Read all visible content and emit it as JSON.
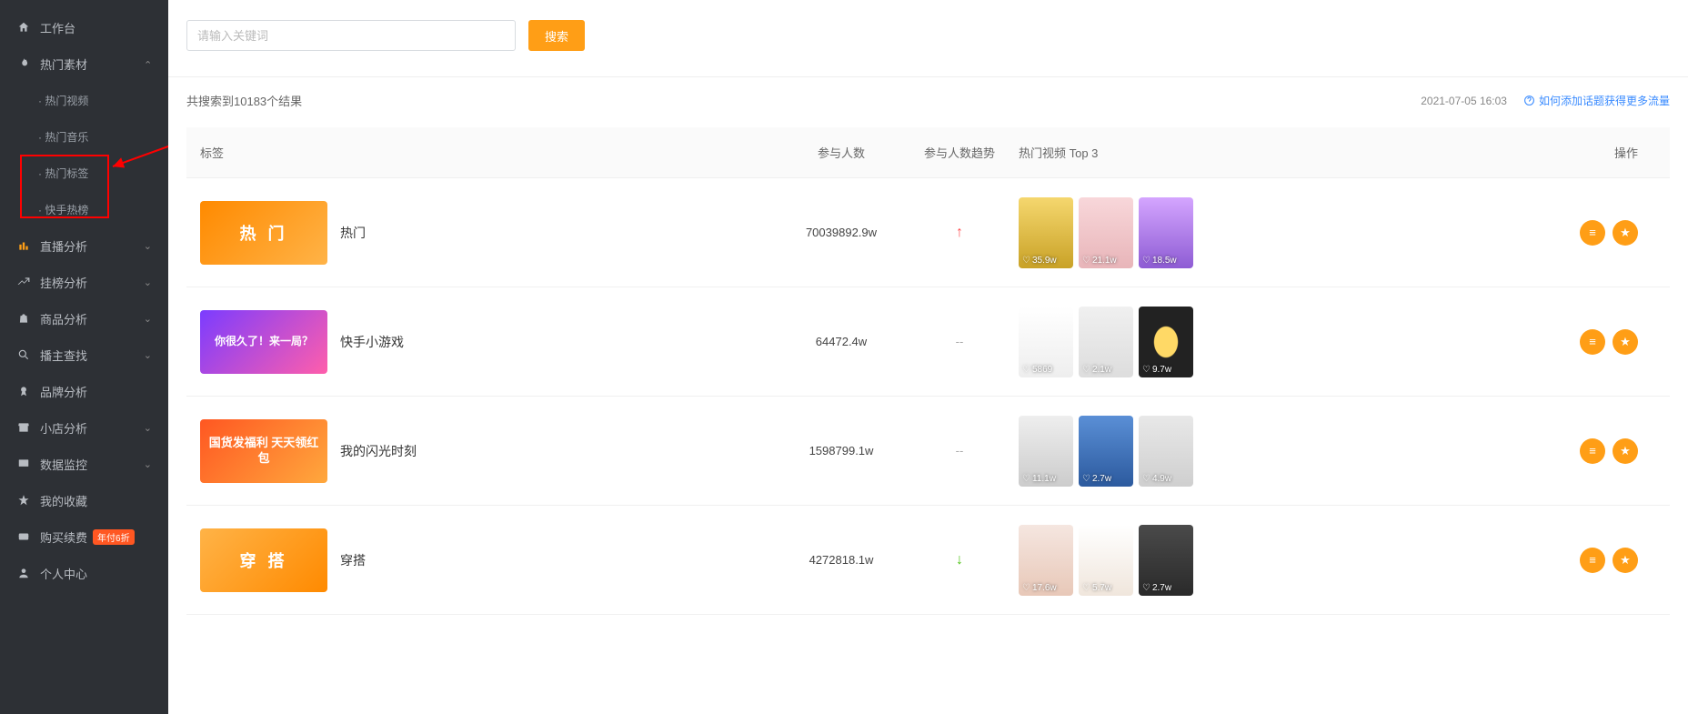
{
  "sidebar": {
    "workbench": "工作台",
    "hot_material": "热门素材",
    "subs": {
      "hot_video": "· 热门视频",
      "hot_music": "· 热门音乐",
      "hot_tags": "· 热门标签",
      "ks_hotlist": "· 快手热榜"
    },
    "live_analysis": "直播分析",
    "rank_analysis": "挂榜分析",
    "product_analysis": "商品分析",
    "anchor_search": "播主查找",
    "brand_analysis": "品牌分析",
    "shop_analysis": "小店分析",
    "data_monitor": "数据监控",
    "my_fav": "我的收藏",
    "purchase": "购买续费",
    "purchase_badge": "年付6折",
    "personal": "个人中心"
  },
  "search": {
    "placeholder": "请输入关键词",
    "button": "搜索"
  },
  "results": {
    "prefix": "共搜索到",
    "count": "10183",
    "suffix": "个结果",
    "timestamp": "2021-07-05 16:03",
    "help_link": "如何添加话题获得更多流量"
  },
  "table": {
    "headers": {
      "tag": "标签",
      "count": "参与人数",
      "trend": "参与人数趋势",
      "top3": "热门视频 Top 3",
      "action": "操作"
    },
    "rows": [
      {
        "thumb_text": "热 门",
        "name": "热门",
        "count": "70039892.9w",
        "trend": "up",
        "top3": [
          {
            "likes": "35.9w"
          },
          {
            "likes": "21.1w"
          },
          {
            "likes": "18.5w"
          }
        ]
      },
      {
        "thumb_text": "你很久了！来一局？",
        "name": "快手小游戏",
        "count": "64472.4w",
        "trend": "none",
        "top3": [
          {
            "likes": "5869"
          },
          {
            "likes": "2.1w"
          },
          {
            "likes": "9.7w"
          }
        ]
      },
      {
        "thumb_text": "国货发福利 天天领红包",
        "name": "我的闪光时刻",
        "count": "1598799.1w",
        "trend": "none",
        "top3": [
          {
            "likes": "11.1w"
          },
          {
            "likes": "2.7w"
          },
          {
            "likes": "4.9w"
          }
        ]
      },
      {
        "thumb_text": "穿 搭",
        "name": "穿搭",
        "count": "4272818.1w",
        "trend": "down",
        "top3": [
          {
            "likes": "17.6w"
          },
          {
            "likes": "5.7w"
          },
          {
            "likes": "2.7w"
          }
        ]
      }
    ]
  }
}
